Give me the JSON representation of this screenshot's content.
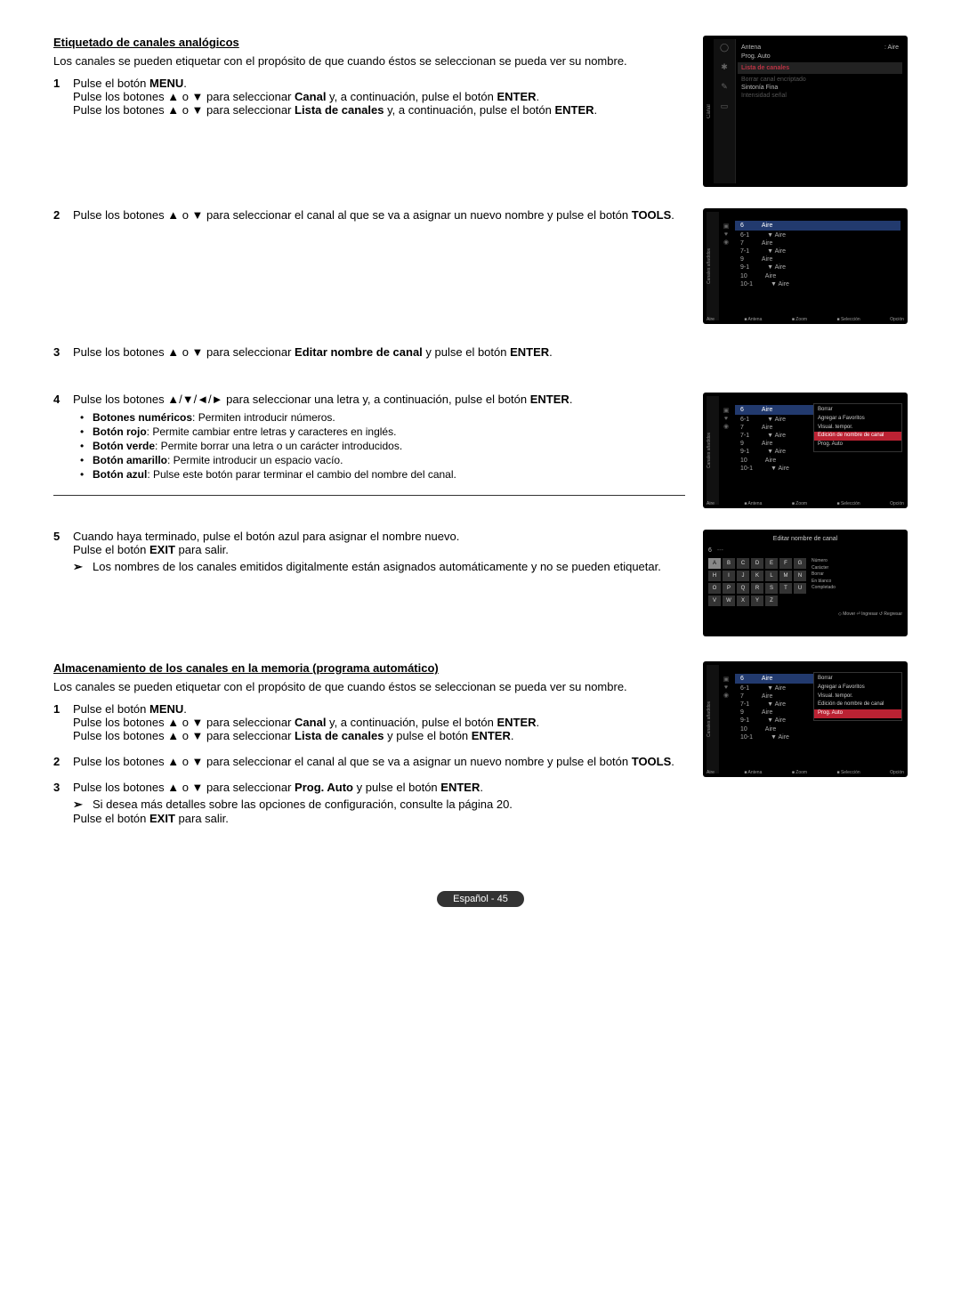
{
  "section1": {
    "heading": "Etiquetado de canales analógicos",
    "intro": "Los canales se pueden etiquetar con el propósito de que cuando éstos se seleccionan se pueda ver su nombre.",
    "step1": {
      "l1a": "Pulse el botón ",
      "l1b": "MENU",
      "l1c": ".",
      "l2a": "Pulse los botones ▲ o ▼ para seleccionar ",
      "l2b": "Canal",
      "l2c": " y, a continuación, pulse el botón ",
      "l2d": "ENTER",
      "l2e": ".",
      "l3a": "Pulse los botones ▲ o ▼ para seleccionar ",
      "l3b": "Lista de canales",
      "l3c": " y, a continuación, pulse el botón ",
      "l3d": "ENTER",
      "l3e": "."
    },
    "step2": {
      "l1a": "Pulse los botones ▲ o ▼ para seleccionar el canal al que se va a asignar un nuevo nombre y pulse el botón ",
      "l1b": "TOOLS",
      "l1c": "."
    },
    "step3": {
      "l1a": "Pulse los botones ▲ o ▼ para seleccionar ",
      "l1b": "Editar nombre de canal",
      "l1c": " y pulse el botón ",
      "l1d": "ENTER",
      "l1e": "."
    },
    "step4": {
      "l1a": "Pulse los botones ▲/▼/◄/► para seleccionar una letra y, a continuación, pulse el botón ",
      "l1b": "ENTER",
      "l1c": ".",
      "b1a": "Botones numéricos",
      "b1b": ": Permiten introducir números.",
      "b2a": "Botón rojo",
      "b2b": ": Permite cambiar entre letras y caracteres en inglés.",
      "b3a": "Botón verde",
      "b3b": ": Permite borrar una letra o un carácter introducidos.",
      "b4a": "Botón amarillo",
      "b4b": ": Permite introducir un espacio vacío.",
      "b5a": "Botón azul",
      "b5b": ": Pulse este botón parar terminar el cambio del nombre del canal."
    },
    "step5": {
      "l1": "Cuando haya terminado, pulse el botón azul para asignar el nombre nuevo.",
      "l2a": "Pulse el botón ",
      "l2b": "EXIT",
      "l2c": " para salir.",
      "note": "Los nombres de los canales emitidos digitalmente están asignados automáticamente y no se pueden etiquetar."
    }
  },
  "section2": {
    "heading": "Almacenamiento de los canales en la memoria (programa automático)",
    "intro": "Los canales se pueden etiquetar con el propósito de que cuando éstos se seleccionan se pueda ver su nombre.",
    "step1": {
      "l1a": "Pulse el botón ",
      "l1b": "MENU",
      "l1c": ".",
      "l2a": "Pulse los botones ▲ o ▼ para seleccionar ",
      "l2b": "Canal",
      "l2c": " y, a continuación, pulse el botón ",
      "l2d": "ENTER",
      "l2e": ".",
      "l3a": "Pulse los botones ▲ o ▼ para seleccionar ",
      "l3b": "Lista de canales",
      "l3c": " y pulse el botón ",
      "l3d": "ENTER",
      "l3e": "."
    },
    "step2": {
      "l1a": "Pulse los botones ▲ o ▼ para seleccionar el canal al que se va a asignar un nuevo nombre y pulse el botón ",
      "l1b": "TOOLS",
      "l1c": "."
    },
    "step3": {
      "l1a": "Pulse los botones ▲ o ▼ para seleccionar ",
      "l1b": "Prog. Auto",
      "l1c": " y pulse el botón ",
      "l1d": "ENTER",
      "l1e": ".",
      "note": "Si desea más detalles sobre las opciones de configuración, consulte la página 20.",
      "l2a": "Pulse el botón ",
      "l2b": "EXIT",
      "l2c": " para salir."
    }
  },
  "osd_menu": {
    "sidebar_label": "Canal",
    "antena": "Antena",
    "antena_val": ": Aire",
    "prog_auto": "Prog. Auto",
    "lista": "Lista de canales",
    "borrar": "Borrar canal encriptado",
    "sintonia": "Sintonía Fina",
    "intens": "Intensidad señal",
    "icon1": "◯",
    "icon2": "✱",
    "icon3": "✎",
    "icon4": "▭"
  },
  "osd_list": {
    "sidelabel": "Canales añadidos",
    "hdr_ch": "6",
    "hdr_name": "Aire",
    "rows": [
      {
        "ch": "6-1",
        "name": "▼ Aire"
      },
      {
        "ch": "7",
        "name": "Aire"
      },
      {
        "ch": "7-1",
        "name": "▼ Aire"
      },
      {
        "ch": "9",
        "name": "Aire"
      },
      {
        "ch": "9-1",
        "name": "▼ Aire"
      },
      {
        "ch": "10",
        "name": "Aire"
      },
      {
        "ch": "10-1",
        "name": "▼ Aire"
      }
    ],
    "foot1": "Aire",
    "foot2": "■ Antena",
    "foot3": "■ Zoom",
    "foot4": "■ Selección",
    "foot5": "Opción"
  },
  "osd_popup": {
    "items": [
      "Borrar",
      "Agregar a Favoritos",
      "Visual. tempor.",
      "Edición de nombre de canal",
      "Prog. Auto"
    ],
    "highlight_edit": 3,
    "highlight_prog": 4
  },
  "osd_keyboard": {
    "title": "Editar nombre de canal",
    "ch": "6",
    "dash": "---",
    "keys": [
      "A",
      "B",
      "C",
      "D",
      "E",
      "F",
      "G",
      "H",
      "I",
      "J",
      "K",
      "L",
      "M",
      "N",
      "O",
      "P",
      "Q",
      "R",
      "S",
      "T",
      "U",
      "V",
      "W",
      "X",
      "Y",
      "Z"
    ],
    "legend": [
      "Número",
      "Carácter",
      "Borrar",
      "En blanco",
      "Completado"
    ],
    "footer": "◇ Mover  ⏎ Ingresar  ↺ Regresar"
  },
  "page_footer": "Español - 45",
  "nums": {
    "n1": "1",
    "n2": "2",
    "n3": "3",
    "n4": "4",
    "n5": "5"
  },
  "sym": {
    "note": "➢"
  }
}
